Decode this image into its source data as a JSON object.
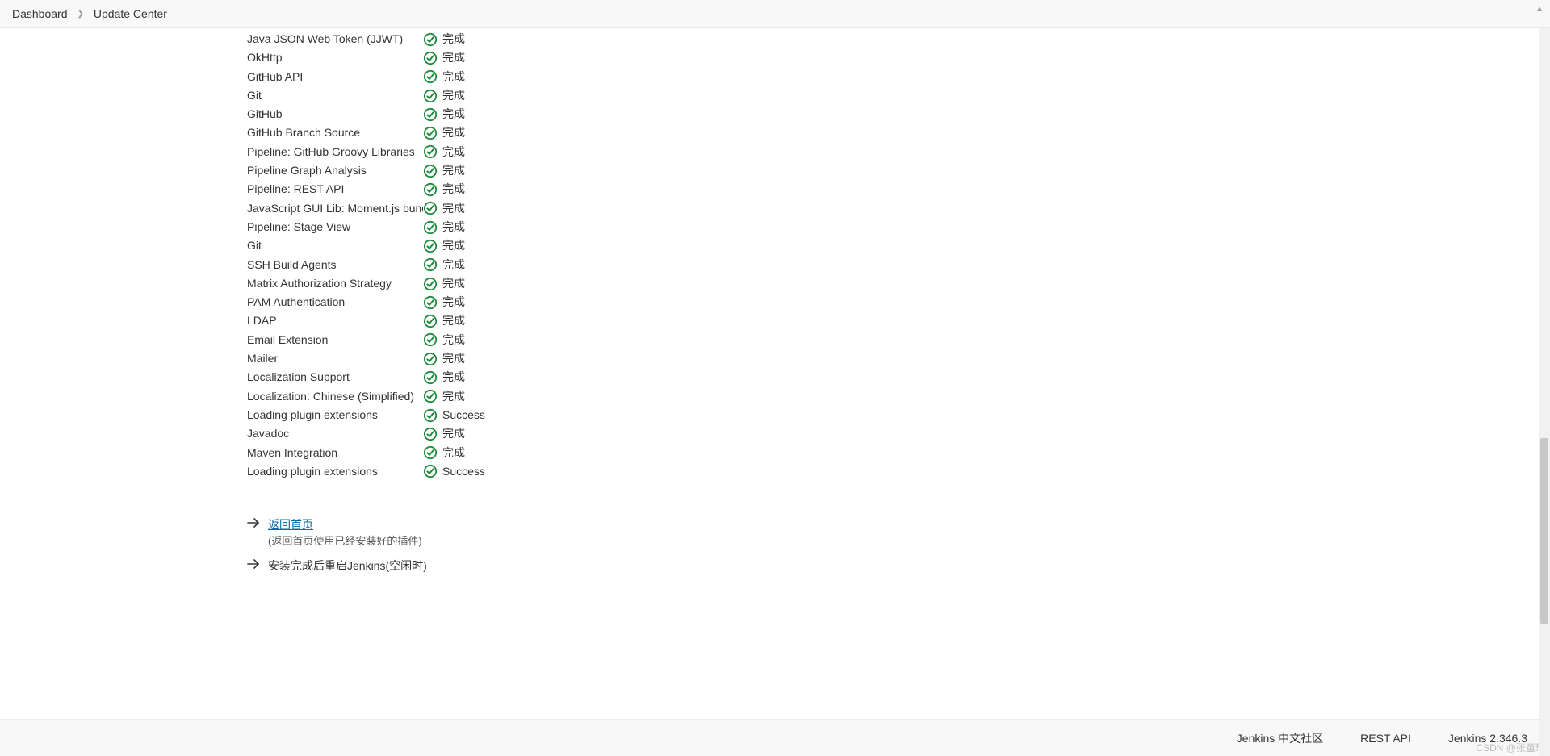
{
  "breadcrumb": {
    "items": [
      "Dashboard",
      "Update Center"
    ]
  },
  "plugins": [
    {
      "name": "Java JSON Web Token (JJWT)",
      "status": "完成"
    },
    {
      "name": "OkHttp",
      "status": "完成"
    },
    {
      "name": "GitHub API",
      "status": "完成"
    },
    {
      "name": "Git",
      "status": "完成"
    },
    {
      "name": "GitHub",
      "status": "完成"
    },
    {
      "name": "GitHub Branch Source",
      "status": "完成"
    },
    {
      "name": "Pipeline: GitHub Groovy Libraries",
      "status": "完成"
    },
    {
      "name": "Pipeline Graph Analysis",
      "status": "完成"
    },
    {
      "name": "Pipeline: REST API",
      "status": "完成"
    },
    {
      "name": "JavaScript GUI Lib: Moment.js bundle",
      "status": "完成"
    },
    {
      "name": "Pipeline: Stage View",
      "status": "完成"
    },
    {
      "name": "Git",
      "status": "完成"
    },
    {
      "name": "SSH Build Agents",
      "status": "完成"
    },
    {
      "name": "Matrix Authorization Strategy",
      "status": "完成"
    },
    {
      "name": "PAM Authentication",
      "status": "完成"
    },
    {
      "name": "LDAP",
      "status": "完成"
    },
    {
      "name": "Email Extension",
      "status": "完成"
    },
    {
      "name": "Mailer",
      "status": "完成"
    },
    {
      "name": "Localization Support",
      "status": "完成"
    },
    {
      "name": "Localization: Chinese (Simplified)",
      "status": "完成"
    },
    {
      "name": "Loading plugin extensions",
      "status": "Success"
    },
    {
      "name": "Javadoc",
      "status": "完成"
    },
    {
      "name": "Maven Integration",
      "status": "完成"
    },
    {
      "name": "Loading plugin extensions",
      "status": "Success"
    }
  ],
  "actions": {
    "back_link": "返回首页",
    "back_note": "(返回首页使用已经安装好的插件)",
    "restart_label": "安装完成后重启Jenkins(空闲时)"
  },
  "footer": {
    "community": "Jenkins 中文社区",
    "rest_api": "REST API",
    "version": "Jenkins 2.346.3"
  },
  "watermark": "CSDN @张童瑶"
}
